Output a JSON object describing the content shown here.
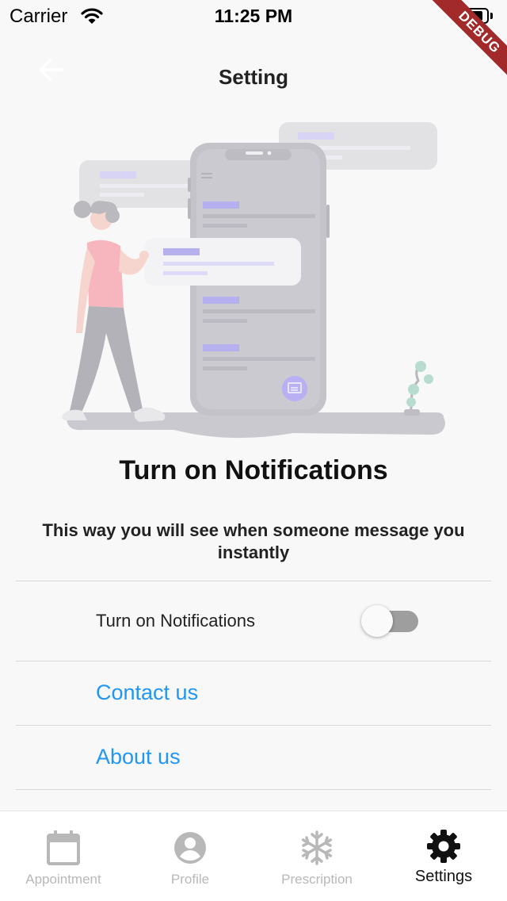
{
  "status_bar": {
    "carrier": "Carrier",
    "time": "11:25 PM",
    "wifi_icon": "wifi-icon",
    "battery_icon": "battery-icon"
  },
  "debug_banner": "DEBUG",
  "header": {
    "title": "Setting",
    "back_icon": "arrow-left-icon"
  },
  "hero": {
    "illustration": "notifications-illustration"
  },
  "intro": {
    "headline": "Turn on Notifications",
    "subline": "This way you will see when someone message you instantly"
  },
  "settings": {
    "notifications_label": "Turn on Notifications",
    "notifications_enabled": false,
    "contact_label": "Contact us",
    "about_label": "About us"
  },
  "colors": {
    "link": "#2196f3",
    "toggle_track_off": "#9e9e9e",
    "illustration_accent": "#a99ff5",
    "nav_inactive": "#b8b8b8",
    "nav_active": "#111111"
  },
  "bottom_nav": {
    "items": [
      {
        "label": "Appointment",
        "icon": "calendar-icon",
        "active": false
      },
      {
        "label": "Profile",
        "icon": "account-circle-icon",
        "active": false
      },
      {
        "label": "Prescription",
        "icon": "snowflake-icon",
        "active": false
      },
      {
        "label": "Settings",
        "icon": "gear-icon",
        "active": true
      }
    ]
  }
}
